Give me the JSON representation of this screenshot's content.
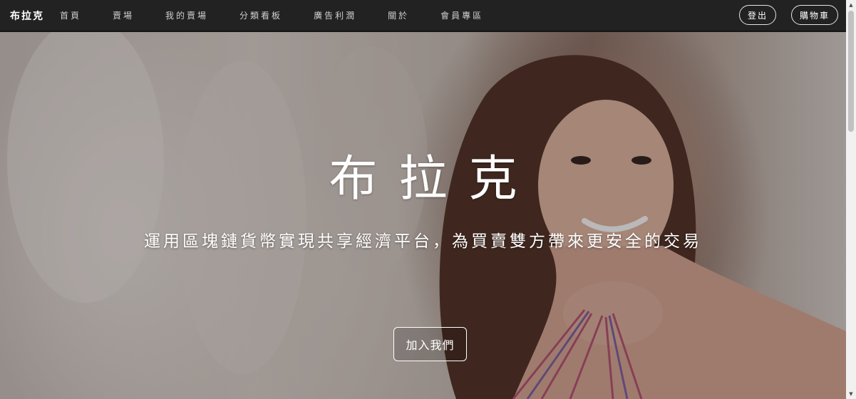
{
  "navbar": {
    "brand": "布拉克",
    "links": [
      {
        "label": "首頁"
      },
      {
        "label": "賣場"
      },
      {
        "label": "我的賣場"
      },
      {
        "label": "分類看板"
      },
      {
        "label": "廣告利潤"
      },
      {
        "label": "關於"
      },
      {
        "label": "會員專區"
      }
    ],
    "logout_label": "登出",
    "cart_label": "購物車"
  },
  "hero": {
    "title": "布拉克",
    "subtitle": "運用區塊鏈貨幣實現共享經濟平台，為買賣雙方帶來更安全的交易",
    "join_label": "加入我們"
  },
  "colors": {
    "navbar_bg": "#222222",
    "text": "#ffffff"
  },
  "icons": {
    "scroll_up": "scroll-up-arrow-icon",
    "scroll_down": "scroll-down-arrow-icon"
  }
}
